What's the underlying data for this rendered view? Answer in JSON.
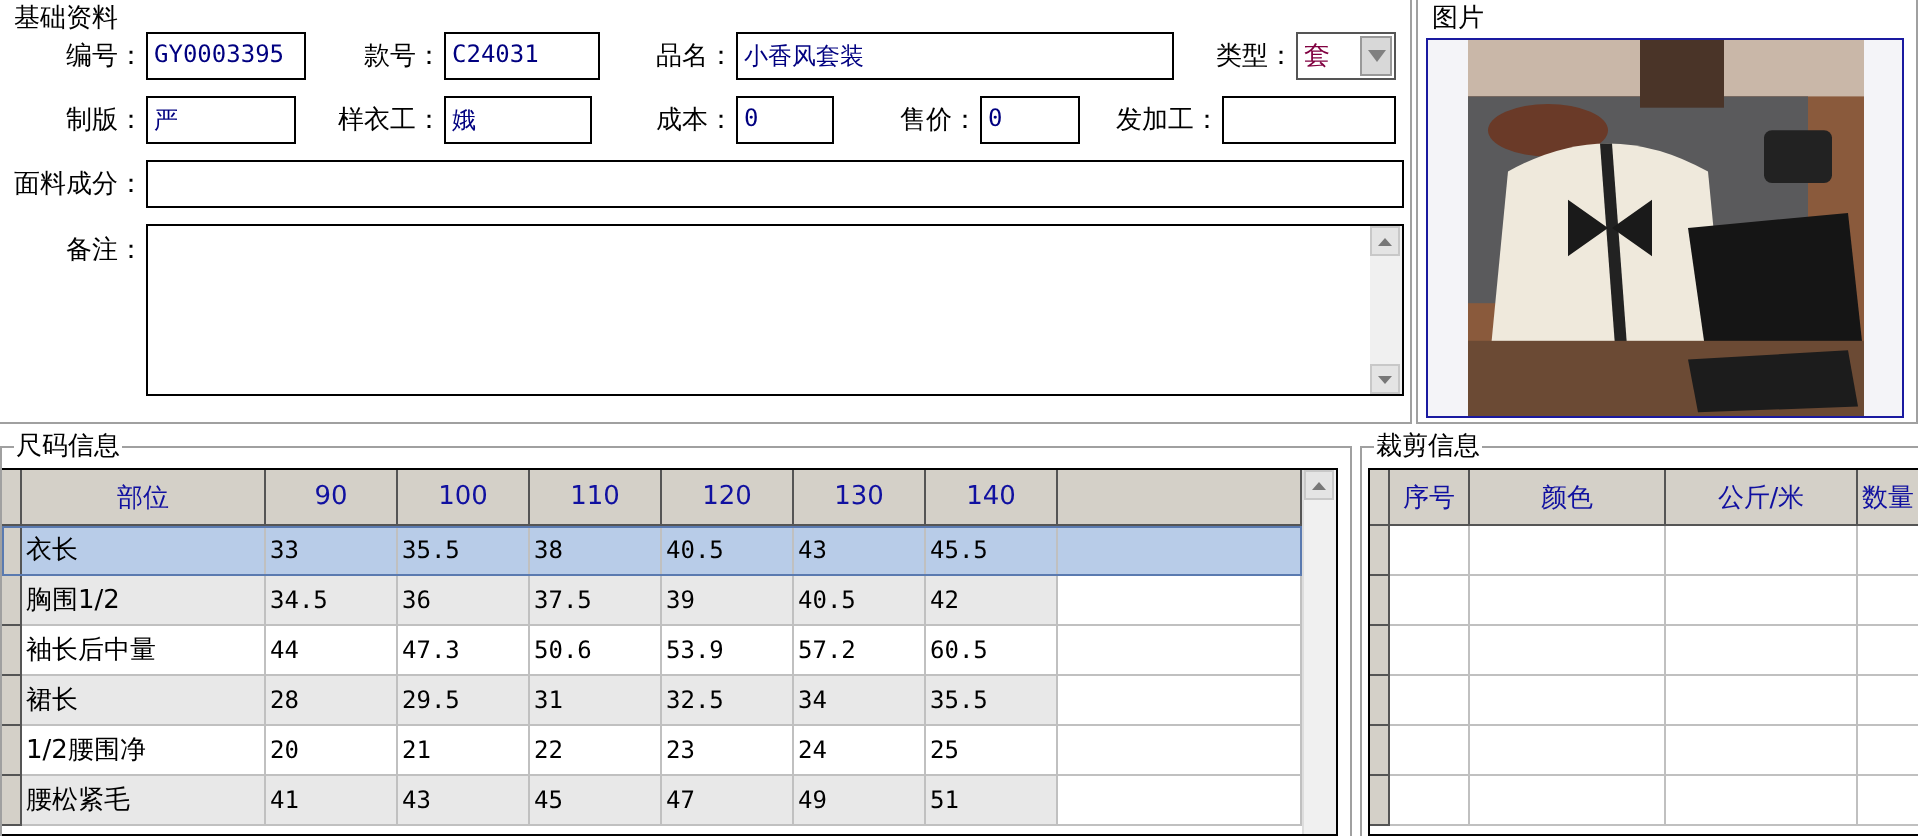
{
  "basic_info": {
    "title": "基础资料",
    "rows": [
      [
        {
          "label": "编号：",
          "value": "GY0003395",
          "kind": "text"
        },
        {
          "label": "款号：",
          "value": "C24031",
          "kind": "text"
        },
        {
          "label": "品名：",
          "value": "小香风套装",
          "kind": "text"
        },
        {
          "label": "类型：",
          "value": "套",
          "kind": "select"
        }
      ],
      [
        {
          "label": "制版：",
          "value": "严",
          "kind": "text"
        },
        {
          "label": "样衣工：",
          "value": "娥",
          "kind": "text"
        },
        {
          "label": "成本：",
          "value": "0",
          "kind": "text"
        },
        {
          "label": "售价：",
          "value": "0",
          "kind": "text"
        },
        {
          "label": "发加工：",
          "kind": "text"
        }
      ],
      [
        {
          "label": "面料成分：",
          "kind": "text"
        }
      ],
      [
        {
          "label": "备注：",
          "kind": "textarea"
        }
      ]
    ]
  },
  "picture": {
    "title": "图片",
    "kind": "picture"
  },
  "size_info": {
    "title": "尺码信息",
    "columns": [
      "部位",
      "90",
      "100",
      "110",
      "120",
      "130",
      "140"
    ],
    "rows": [
      {
        "cells": [
          "衣长",
          "33",
          "35.5",
          "38",
          "40.5",
          "43",
          "45.5"
        ],
        "selected": true
      },
      {
        "cells": [
          "胸围1/2",
          "34.5",
          "36",
          "37.5",
          "39",
          "40.5",
          "42"
        ],
        "selected": false
      },
      {
        "cells": [
          "袖长后中量",
          "44",
          "47.3",
          "50.6",
          "53.9",
          "57.2",
          "60.5"
        ],
        "selected": false
      },
      {
        "cells": [
          "裙长",
          "28",
          "29.5",
          "31",
          "32.5",
          "34",
          "35.5"
        ],
        "selected": false
      },
      {
        "cells": [
          "1/2腰围净",
          "20",
          "21",
          "22",
          "23",
          "24",
          "25"
        ],
        "selected": false
      },
      {
        "cells": [
          "腰松紧毛",
          "41",
          "43",
          "45",
          "47",
          "49",
          "51"
        ],
        "selected": false
      }
    ]
  },
  "cut_info": {
    "title": "裁剪信息",
    "columns": [
      "序号",
      "颜色",
      "公斤/米",
      "数量"
    ]
  }
}
